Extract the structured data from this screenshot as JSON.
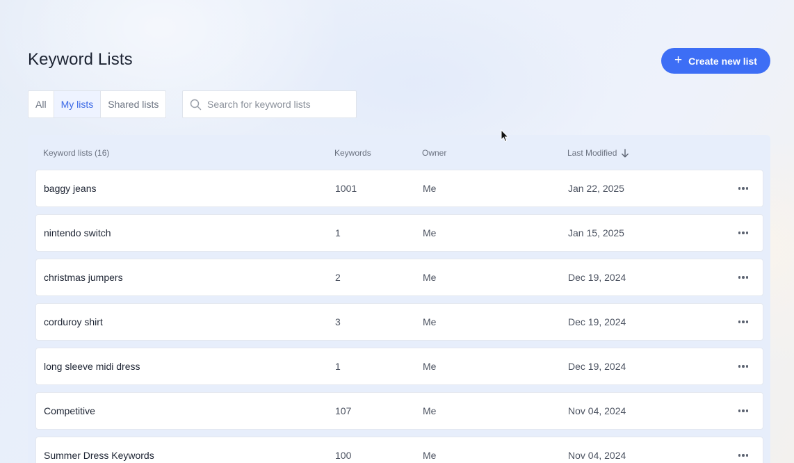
{
  "page": {
    "title": "Keyword Lists"
  },
  "actions": {
    "create_label": "Create new list",
    "create_icon": "plus-icon"
  },
  "filters": {
    "tabs": [
      {
        "label": "All",
        "active": false
      },
      {
        "label": "My lists",
        "active": true
      },
      {
        "label": "Shared lists",
        "active": false
      }
    ]
  },
  "search": {
    "placeholder": "Search for keyword lists",
    "value": ""
  },
  "table": {
    "columns": {
      "name": "Keyword lists (16)",
      "keywords": "Keywords",
      "owner": "Owner",
      "modified": "Last Modified"
    },
    "sort": {
      "column": "modified",
      "direction": "descending",
      "icon": "arrow-down-icon"
    },
    "rows": [
      {
        "name": "baggy jeans",
        "keywords": "1001",
        "owner": "Me",
        "modified": "Jan 22, 2025"
      },
      {
        "name": "nintendo switch",
        "keywords": "1",
        "owner": "Me",
        "modified": "Jan 15, 2025"
      },
      {
        "name": "christmas jumpers",
        "keywords": "2",
        "owner": "Me",
        "modified": "Dec 19, 2024"
      },
      {
        "name": "corduroy shirt",
        "keywords": "3",
        "owner": "Me",
        "modified": "Dec 19, 2024"
      },
      {
        "name": "long sleeve midi dress",
        "keywords": "1",
        "owner": "Me",
        "modified": "Dec 19, 2024"
      },
      {
        "name": "Competitive",
        "keywords": "107",
        "owner": "Me",
        "modified": "Nov 04, 2024"
      },
      {
        "name": "Summer Dress Keywords",
        "keywords": "100",
        "owner": "Me",
        "modified": "Nov 04, 2024"
      }
    ]
  },
  "colors": {
    "accent": "#3d6ef5",
    "active_tab_text": "#3a68e6",
    "active_tab_bg": "#eef3ff",
    "table_panel_bg": "#e7eefb"
  }
}
